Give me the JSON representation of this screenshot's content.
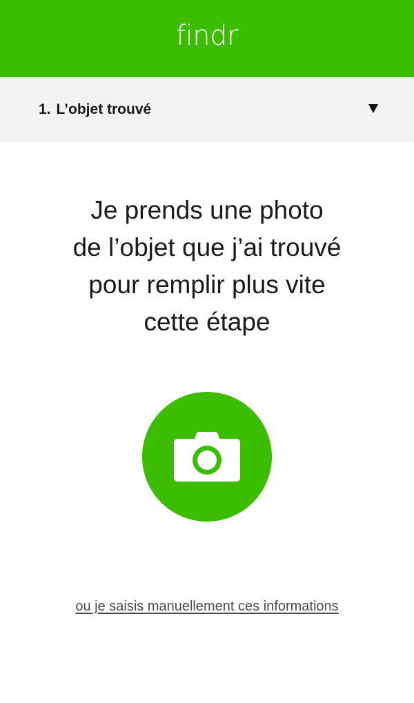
{
  "header": {
    "logo": "findr",
    "background_color": "#3dbd00"
  },
  "step": {
    "number": "1.",
    "title": "L’objet trouvé",
    "toggle_icon": "triangle-down-icon"
  },
  "main": {
    "instruction_lines": [
      "Je prends une photo",
      "de l’objet que j’ai trouvé",
      "pour remplir plus vite",
      "cette étape"
    ],
    "camera_icon": "camera-icon",
    "accent_color": "#3dbd00",
    "manual_link": "ou je saisis manuellement ces informations"
  }
}
